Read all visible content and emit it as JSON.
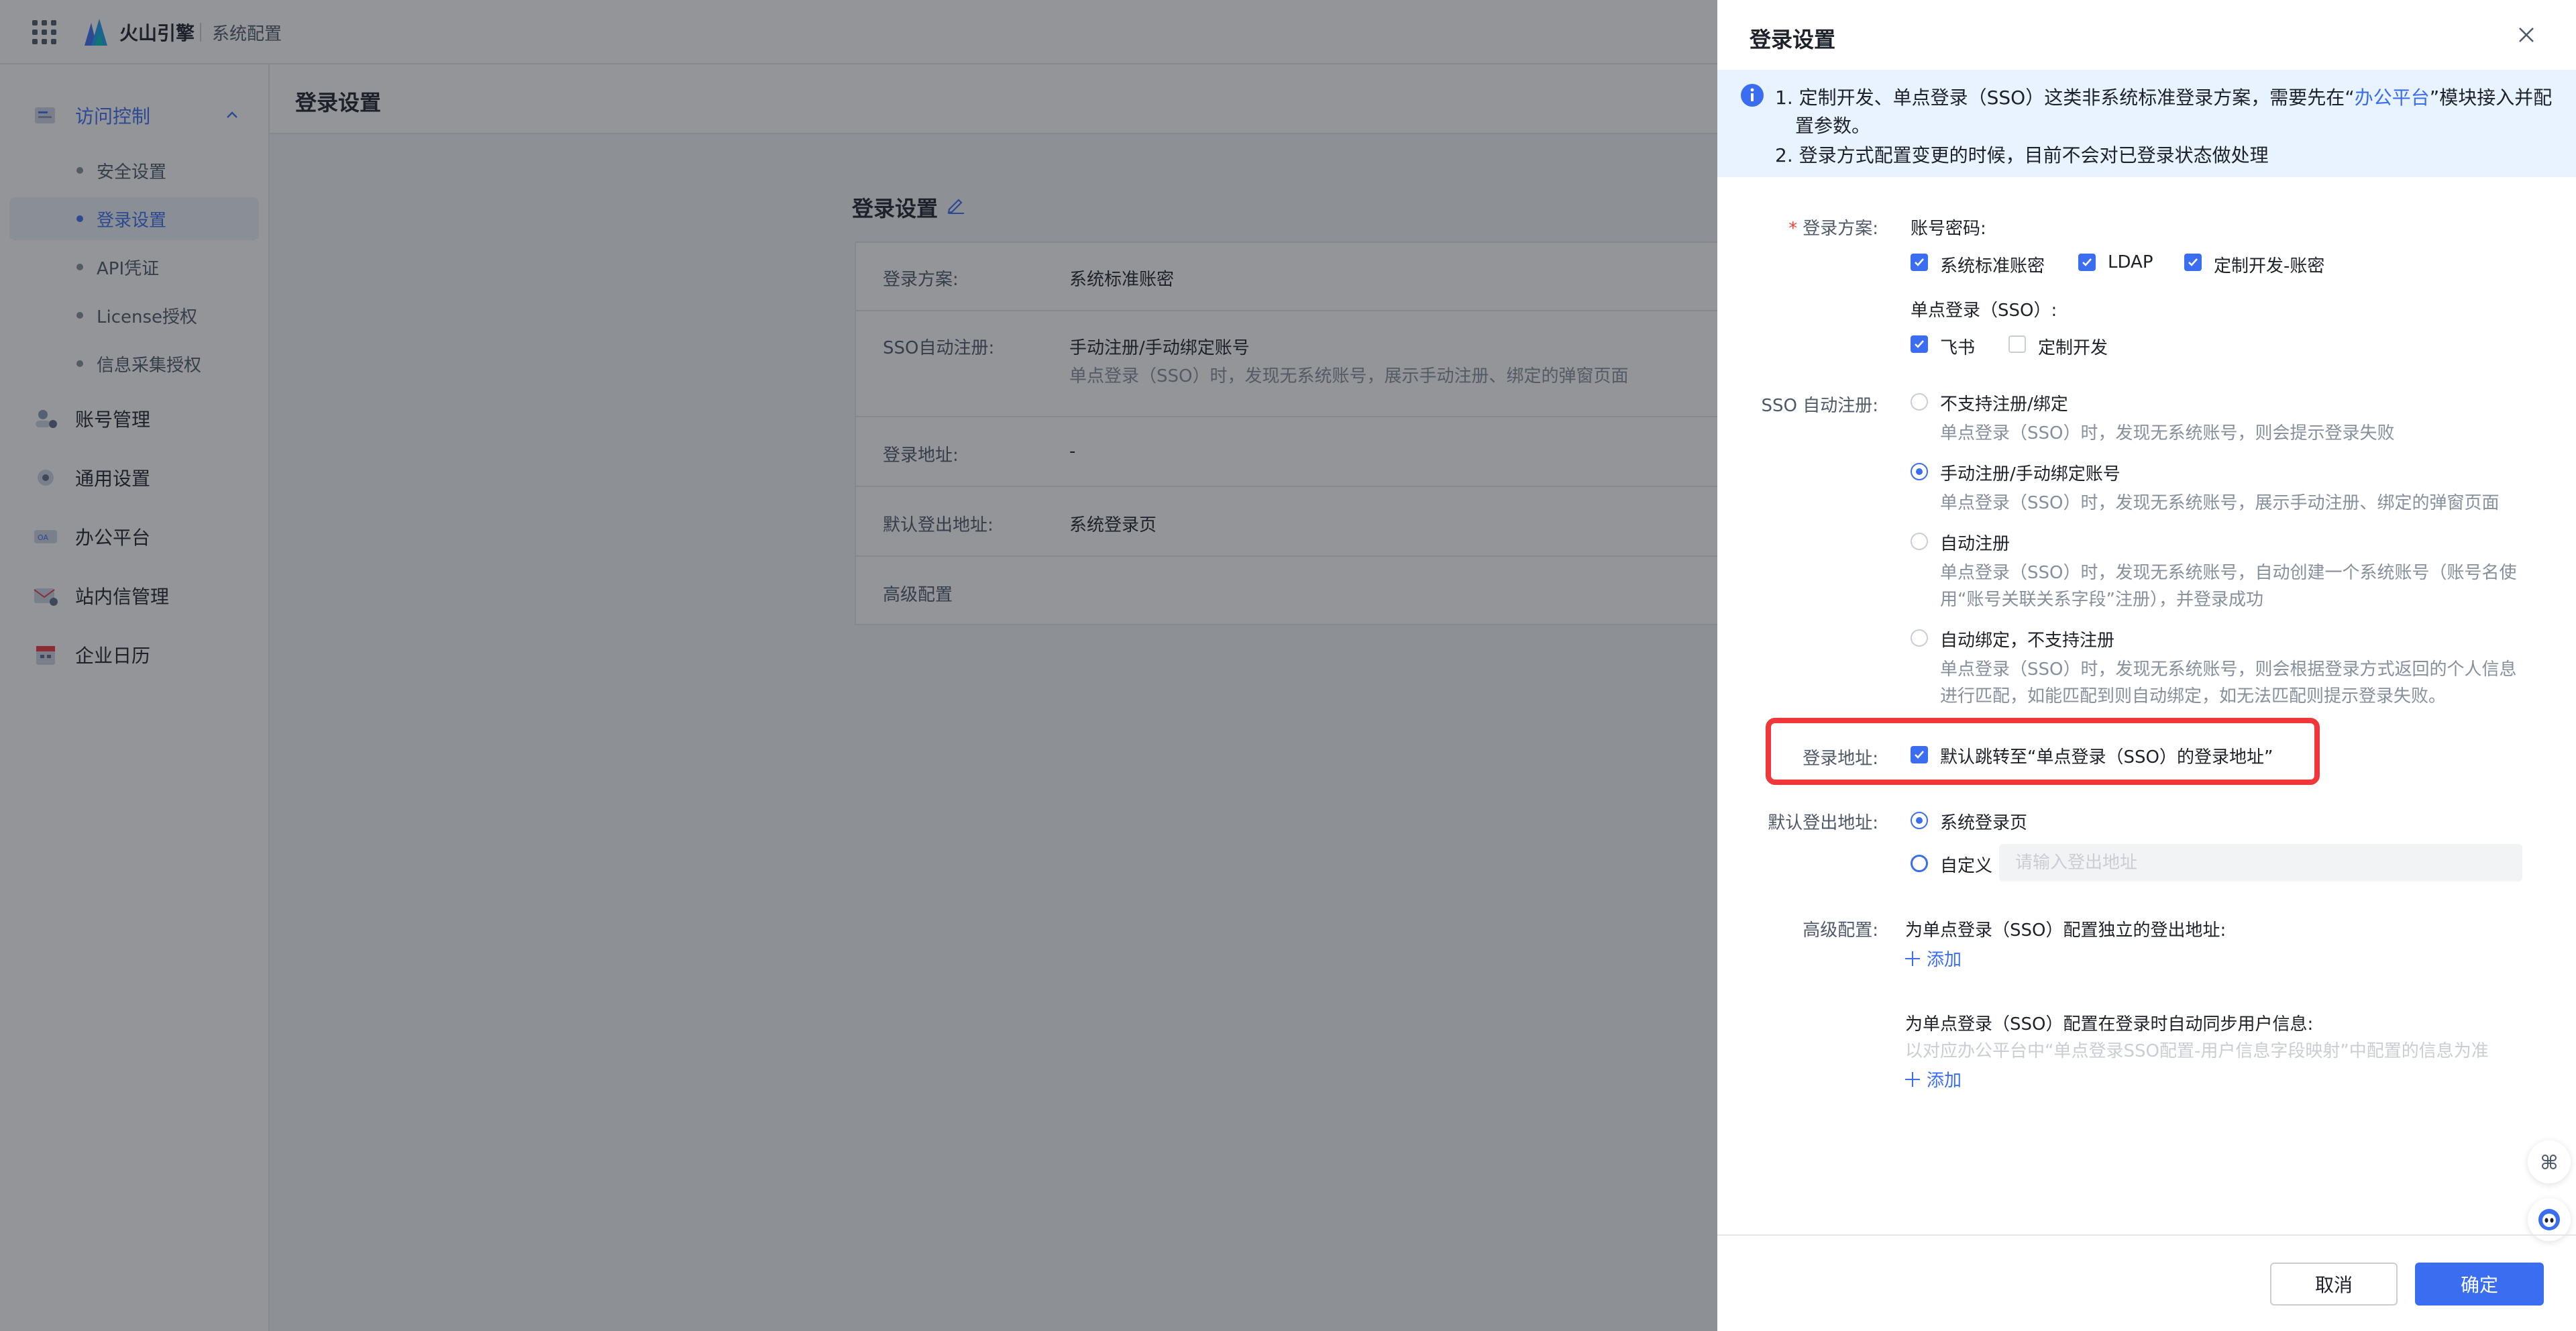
{
  "topbar": {
    "brand": "火山引擎",
    "section": "系统配置"
  },
  "sidebar": {
    "groups": [
      {
        "label": "访问控制",
        "icon": "access-control-icon",
        "expanded": true,
        "children": [
          {
            "label": "安全设置"
          },
          {
            "label": "登录设置",
            "selected": true
          },
          {
            "label": "API凭证"
          },
          {
            "label": "License授权"
          },
          {
            "label": "信息采集授权"
          }
        ]
      },
      {
        "label": "账号管理",
        "icon": "account-icon"
      },
      {
        "label": "通用设置",
        "icon": "settings-icon"
      },
      {
        "label": "办公平台",
        "icon": "office-platform-icon"
      },
      {
        "label": "站内信管理",
        "icon": "mail-icon"
      },
      {
        "label": "企业日历",
        "icon": "calendar-icon"
      }
    ]
  },
  "main": {
    "header_title": "登录设置",
    "card_title": "登录设置",
    "rows": [
      {
        "key": "登录方案:",
        "value": "系统标准账密"
      },
      {
        "key": "SSO自动注册:",
        "value": "手动注册/手动绑定账号",
        "desc": "单点登录（SSO）时，发现无系统账号，展示手动注册、绑定的弹窗页面"
      },
      {
        "key": "登录地址:",
        "value": "-"
      },
      {
        "key": "默认登出地址:",
        "value": "系统登录页"
      },
      {
        "key": "高级配置",
        "value": ""
      }
    ]
  },
  "drawer": {
    "title": "登录设置",
    "alert": {
      "line1_pre": "1. 定制开发、单点登录（SSO）这类非系统标准登录方案，需要先在“",
      "line1_link": "办公平台",
      "line1_post": "”模块接入并配",
      "line1_cont": "置参数。",
      "line2": "2. 登录方式配置变更的时候，目前不会对已登录状态做处理"
    },
    "login_scheme": {
      "label": "登录方案:",
      "account_title": "账号密码:",
      "account_options": [
        {
          "label": "系统标准账密",
          "checked": true
        },
        {
          "label": "LDAP",
          "checked": true
        },
        {
          "label": "定制开发-账密",
          "checked": true
        }
      ],
      "sso_title": "单点登录（SSO）:",
      "sso_options": [
        {
          "label": "飞书",
          "checked": true
        },
        {
          "label": "定制开发",
          "checked": false
        }
      ]
    },
    "sso_auto": {
      "label": "SSO 自动注册:",
      "options": [
        {
          "label": "不支持注册/绑定",
          "desc1": "单点登录（SSO）时，发现无系统账号，则会提示登录失败",
          "desc2": "",
          "selected": false
        },
        {
          "label": "手动注册/手动绑定账号",
          "desc1": "单点登录（SSO）时，发现无系统账号，展示手动注册、绑定的弹窗页面",
          "desc2": "",
          "selected": true
        },
        {
          "label": "自动注册",
          "desc1": "单点登录（SSO）时，发现无系统账号，自动创建一个系统账号（账号名使",
          "desc2": "用“账号关联关系字段”注册），并登录成功",
          "selected": false
        },
        {
          "label": "自动绑定，不支持注册",
          "desc1": "单点登录（SSO）时，发现无系统账号，则会根据登录方式返回的个人信息",
          "desc2": "进行匹配，如能匹配到则自动绑定，如无法匹配则提示登录失败。",
          "selected": false
        }
      ]
    },
    "login_addr": {
      "label": "登录地址:",
      "option": "默认跳转至“单点登录（SSO）的登录地址”",
      "checked": true
    },
    "logout": {
      "label": "默认登出地址:",
      "options": [
        {
          "label": "系统登录页",
          "selected": true
        },
        {
          "label": "自定义",
          "selected": false
        }
      ],
      "placeholder": "请输入登出地址"
    },
    "advanced": {
      "label": "高级配置:",
      "item1_title": "为单点登录（SSO）配置独立的登出地址:",
      "item2_title": "为单点登录（SSO）配置在登录时自动同步用户信息:",
      "item2_note": "以对应办公平台中“单点登录SSO配置-用户信息字段映射”中配置的信息为准",
      "add_label": "添加"
    },
    "footer": {
      "cancel": "取消",
      "ok": "确定"
    }
  },
  "colors": {
    "accent": "#3a6df0",
    "highlight": "#f1373a",
    "alert_bg": "#e8f3ff"
  }
}
